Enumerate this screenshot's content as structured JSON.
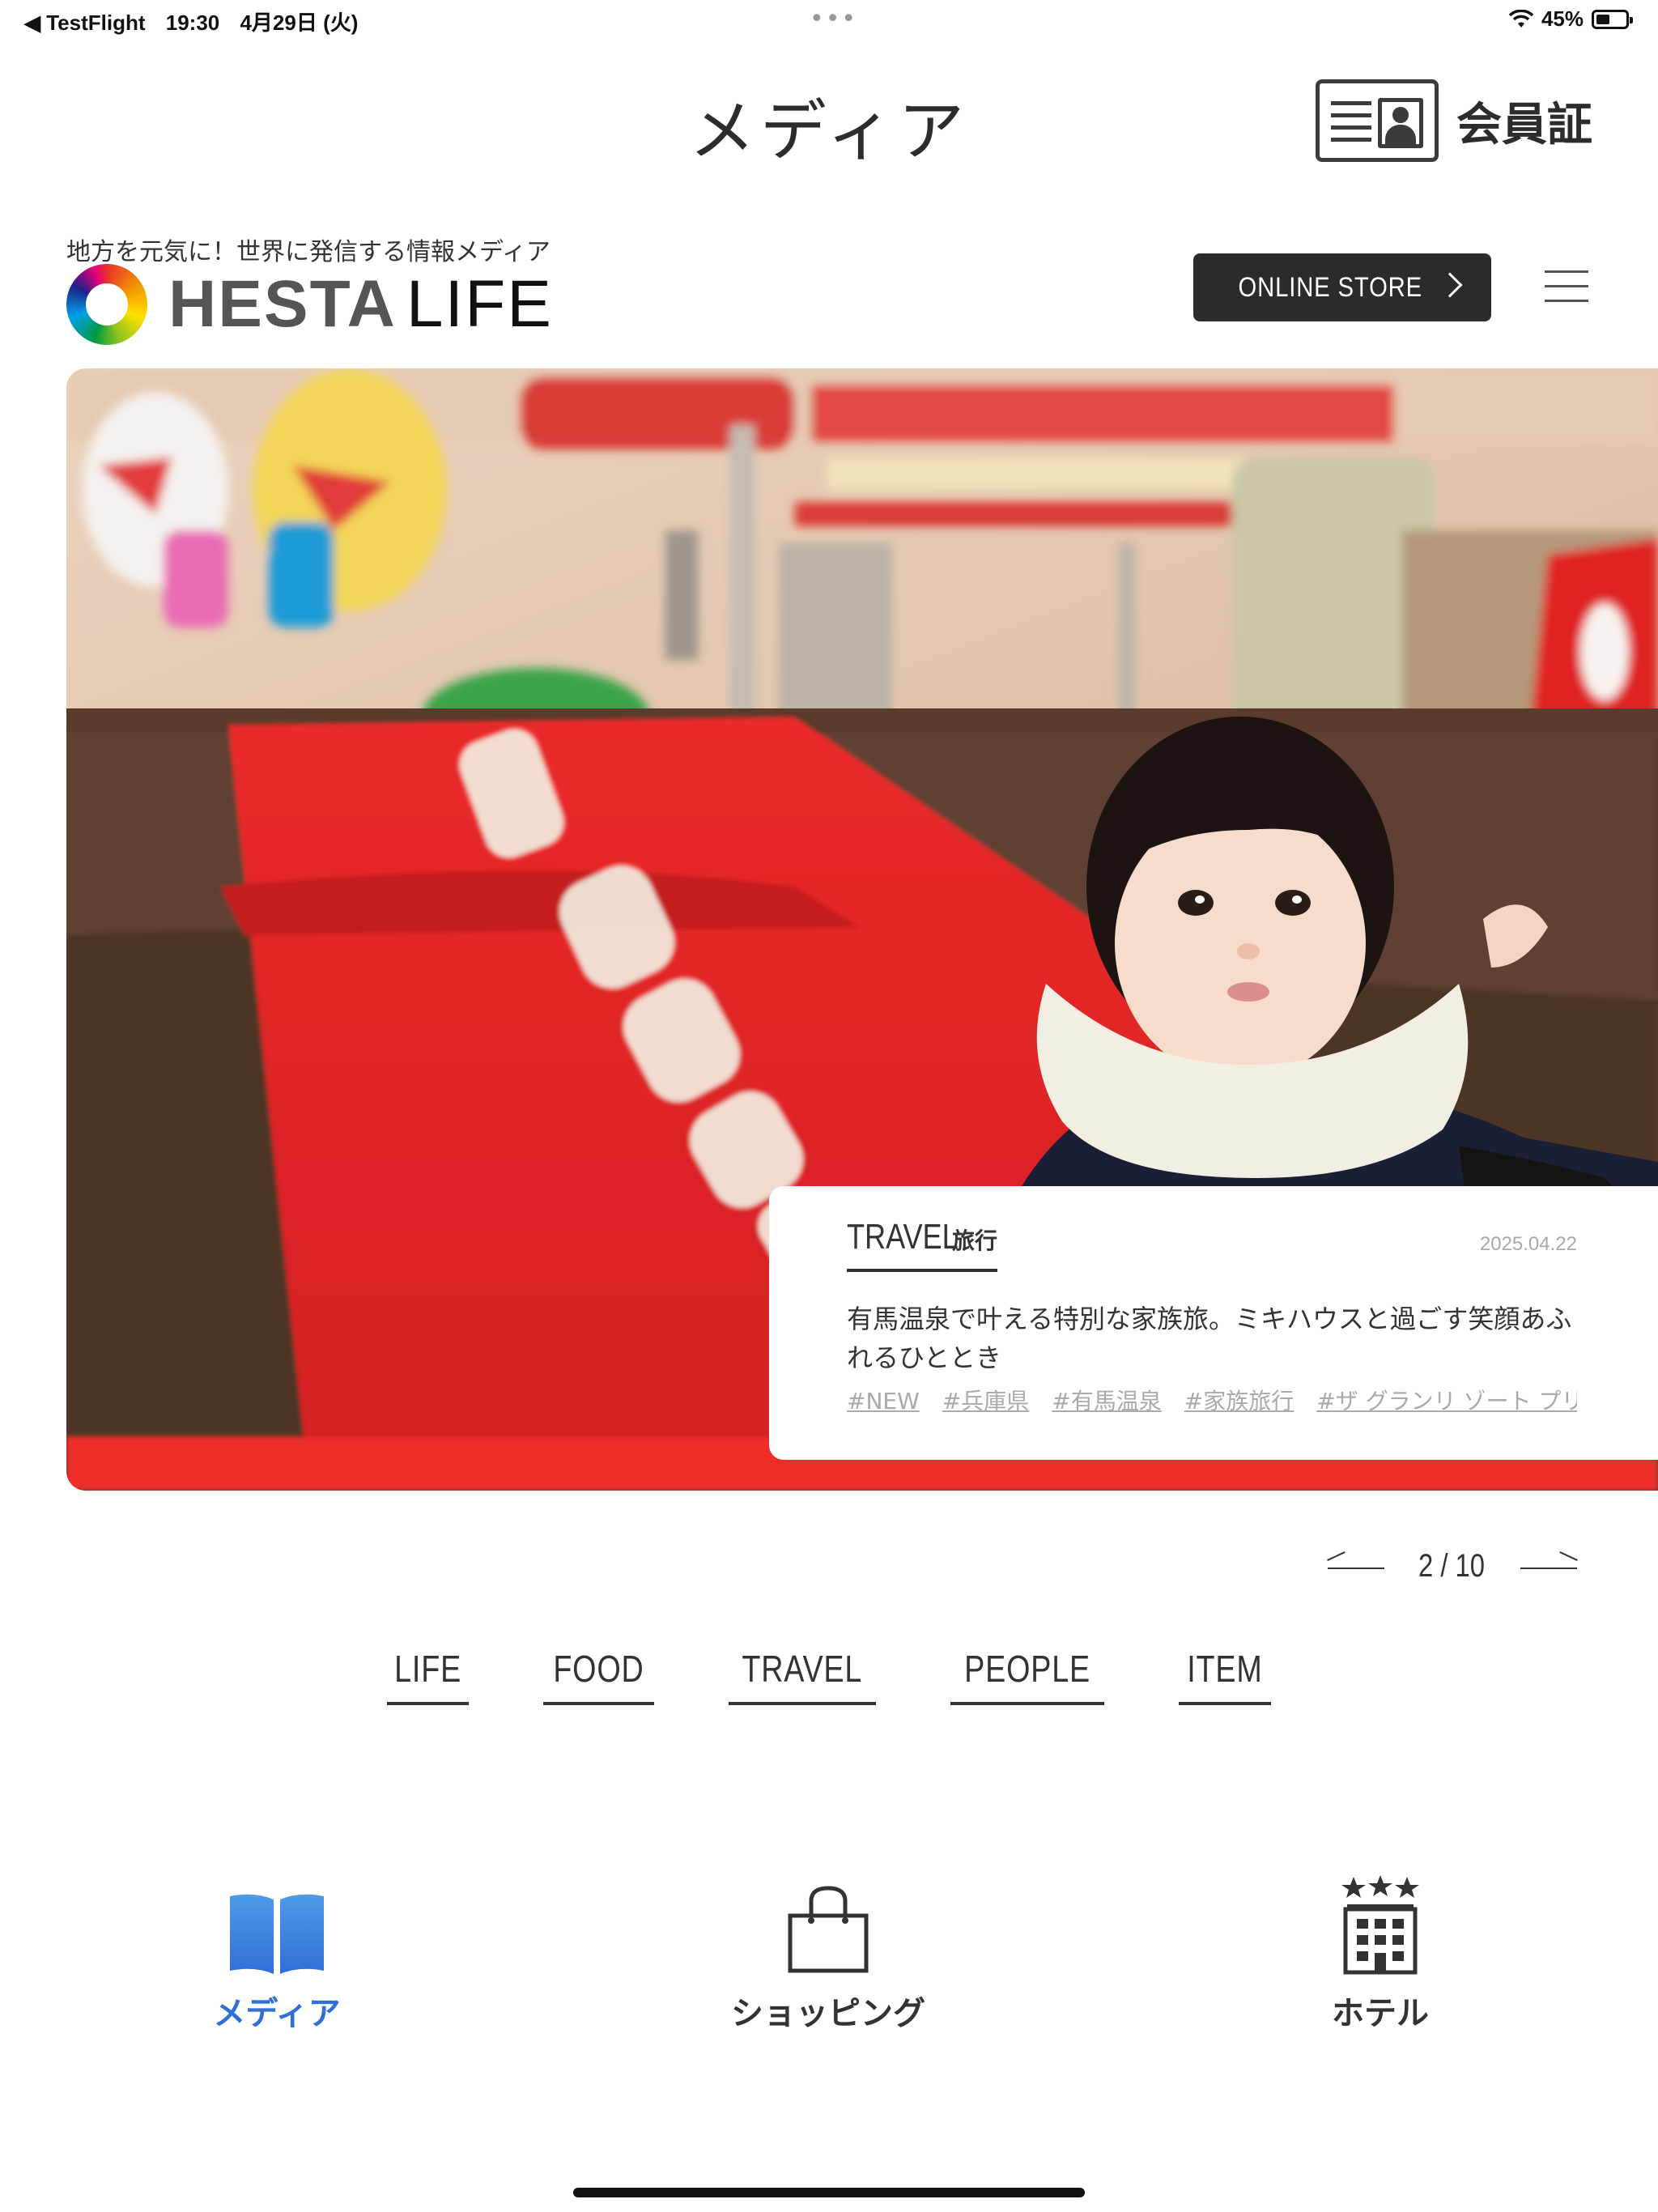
{
  "status_bar": {
    "back_app": "◀ TestFlight",
    "time": "19:30",
    "date": "4月29日 (火)",
    "dots": "•••",
    "battery": "45%"
  },
  "header": {
    "title": "メディア",
    "member_card_label": "会員証"
  },
  "site": {
    "tagline": "地方を元気に！世界に発信する情報メディア",
    "logo_hesta": "HESTA",
    "logo_life": "LIFE",
    "online_store_label": "ONLINE STORE"
  },
  "hero": {
    "category_en": "TRAVEL",
    "category_jp": "旅行",
    "date": "2025.04.22",
    "title": "有馬温泉で叶える特別な家族旅。ミキハウスと過ごす笑顔あふれるひととき",
    "tags": [
      "#NEW",
      "#兵庫県",
      "#有馬温泉",
      "#家族旅行",
      "#ザ グランリ ゾート プリンセス"
    ]
  },
  "pager": {
    "current": "2",
    "total": "10",
    "display": "2 / 10"
  },
  "categories": [
    "LIFE",
    "FOOD",
    "TRAVEL",
    "PEOPLE",
    "ITEM"
  ],
  "tab_bar": {
    "media": "メディア",
    "shopping": "ショッピング",
    "hotel": "ホテル",
    "active": "media",
    "active_color": "#2f6fd6"
  },
  "colors": {
    "accent_blue": "#2f6fd6",
    "button_dark": "#2b2b2b",
    "blanket_red": "#e8282a"
  }
}
